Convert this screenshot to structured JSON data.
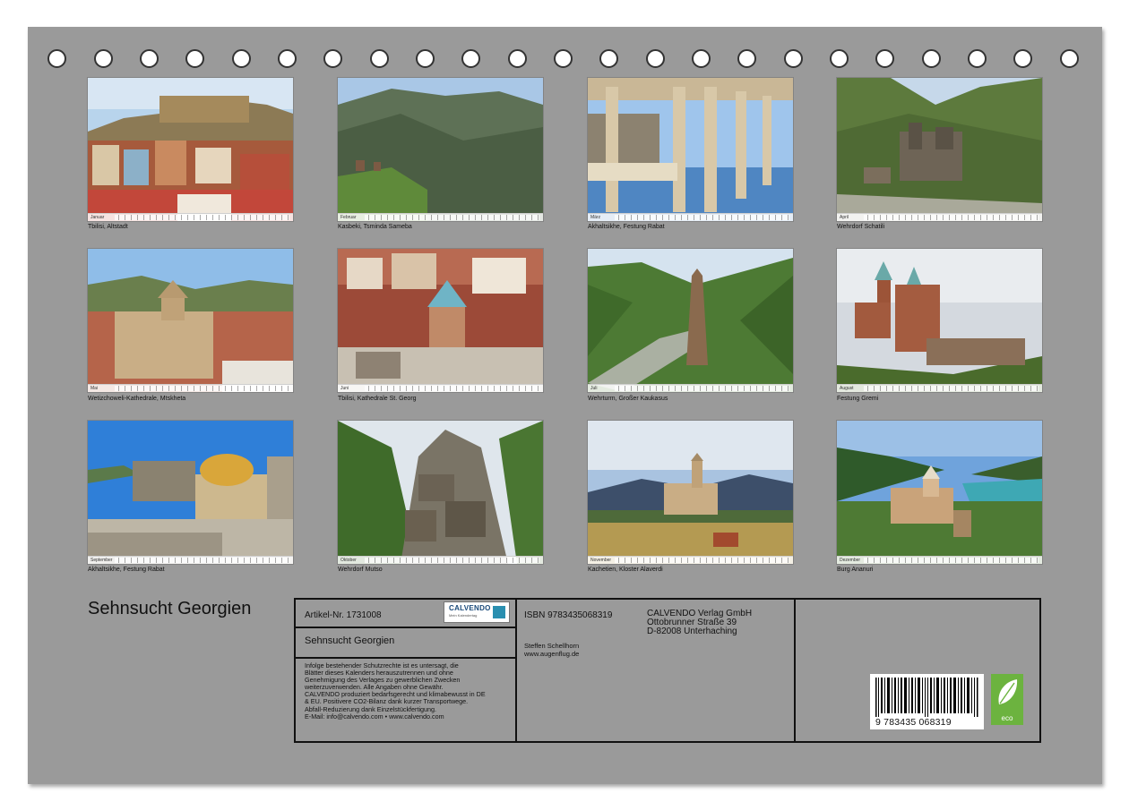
{
  "calendar_title": "Sehnsucht Georgien",
  "photos": [
    {
      "caption": "Tbilisi, Altstadt",
      "month": "Januar"
    },
    {
      "caption": "Kasbeki, Tsminda Sameba",
      "month": "Februar"
    },
    {
      "caption": "Akhaltsikhe, Festung Rabat",
      "month": "März"
    },
    {
      "caption": "Wehrdorf Schatili",
      "month": "April"
    },
    {
      "caption": "Wetizchoweli-Kathedrale, Mtskheta",
      "month": "Mai"
    },
    {
      "caption": "Tbilisi, Kathedrale St. Georg",
      "month": "Juni"
    },
    {
      "caption": "Wehrturm, Großer Kaukasus",
      "month": "Juli"
    },
    {
      "caption": "Festung Gremi",
      "month": "August"
    },
    {
      "caption": "Akhaltsikhe, Festung Rabat",
      "month": "September"
    },
    {
      "caption": "Wehrdorf Mutso",
      "month": "Oktober"
    },
    {
      "caption": "Kachetien, Kloster Alaverdi",
      "month": "November"
    },
    {
      "caption": "Burg Ananuri",
      "month": "Dezember"
    }
  ],
  "info": {
    "article_no": "Artikel-Nr. 1731008",
    "title": "Sehnsucht Georgien",
    "logo_text": "CALVENDO",
    "logo_sub": "Mein Kalendertag",
    "legal_lines": [
      "Infolge bestehender Schutzrechte ist es untersagt, die",
      "Blätter dieses Kalenders herauszutrennen und ohne",
      "Genehmigung des Verlages zu gewerblichen Zwecken",
      "weiterzuverwenden. Alle Angaben ohne Gewähr.",
      "CALVENDO produziert bedarfsgerecht und klimabewusst in DE",
      "& EU. Positivere CO2-Bilanz dank kurzer Transportwege.",
      "Abfall-Reduzierung dank Einzelstückfertigung.",
      "E-Mail: info@calvendo.com • www.calvendo.com"
    ],
    "isbn": "ISBN 9783435068319",
    "author": "Steffen Schellhorn",
    "website": "www.augenflug.de",
    "publisher_lines": [
      "CALVENDO Verlag GmbH",
      "Ottobrunner Straße 39",
      "D-82008 Unterhaching"
    ],
    "barcode_number": "9 783435 068319",
    "eco_label": "eco"
  }
}
